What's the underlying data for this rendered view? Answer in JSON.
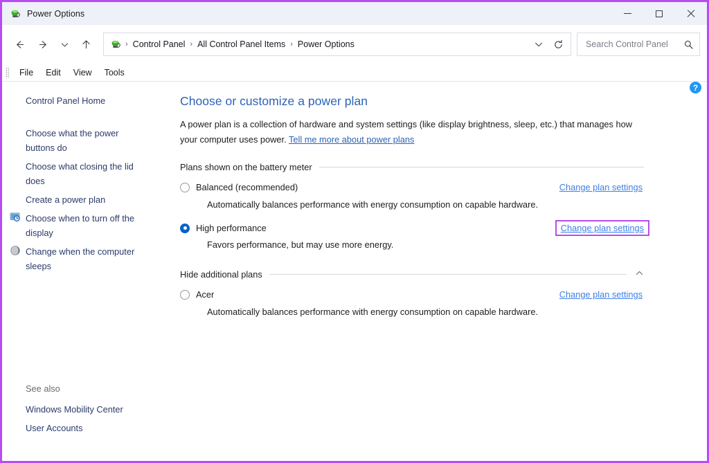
{
  "window": {
    "title": "Power Options",
    "icon": "power-plug-icon",
    "controls": {
      "minimize": "Minimize",
      "maximize": "Maximize",
      "close": "Close"
    },
    "accent_border_color": "#b84cf0",
    "titlebar_bg": "#eef1f8"
  },
  "addressbar": {
    "back": "Back",
    "forward": "Forward",
    "recent": "Recent locations",
    "up": "Up one level",
    "breadcrumb_icon": "power-plug-icon",
    "breadcrumbs": [
      "Control Panel",
      "All Control Panel Items",
      "Power Options"
    ],
    "separator": "›",
    "dropdown": "Previous locations",
    "refresh": "Refresh",
    "search": {
      "placeholder": "Search Control Panel",
      "value": "",
      "icon": "search-icon"
    }
  },
  "menubar": {
    "items": [
      "File",
      "Edit",
      "View",
      "Tools"
    ]
  },
  "sidebar": {
    "home": "Control Panel Home",
    "items": [
      {
        "label": "Choose what the power buttons do",
        "icon": null
      },
      {
        "label": "Choose what closing the lid does",
        "icon": null
      },
      {
        "label": "Create a power plan",
        "icon": null
      },
      {
        "label": "Choose when to turn off the display",
        "icon": "display-clock-icon"
      },
      {
        "label": "Change when the computer sleeps",
        "icon": "sleep-moon-icon"
      }
    ],
    "see_also": {
      "label": "See also",
      "links": [
        "Windows Mobility Center",
        "User Accounts"
      ]
    }
  },
  "main": {
    "help_button": "?",
    "title": "Choose or customize a power plan",
    "intro_text": "A power plan is a collection of hardware and system settings (like display brightness, sleep, etc.) that manages how your computer uses power. ",
    "intro_link": "Tell me more about power plans",
    "sections": [
      {
        "heading": "Plans shown on the battery meter",
        "chevron": null,
        "plans": [
          {
            "name": "Balanced (recommended)",
            "selected": false,
            "description": "Automatically balances performance with energy consumption on capable hardware.",
            "change_link": "Change plan settings",
            "highlighted": false
          },
          {
            "name": "High performance",
            "selected": true,
            "description": "Favors performance, but may use more energy.",
            "change_link": "Change plan settings",
            "highlighted": true
          }
        ]
      },
      {
        "heading": "Hide additional plans",
        "chevron": "chevron-up-icon",
        "plans": [
          {
            "name": "Acer",
            "selected": false,
            "description": "Automatically balances performance with energy consumption on capable hardware.",
            "change_link": "Change plan settings",
            "highlighted": false
          }
        ]
      }
    ]
  }
}
